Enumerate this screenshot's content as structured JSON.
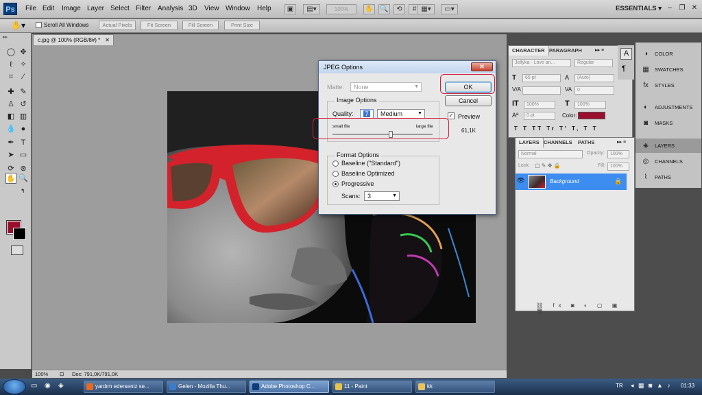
{
  "app": {
    "logo": "Ps",
    "workspace": "ESSENTIALS ▾"
  },
  "menu": [
    "File",
    "Edit",
    "Image",
    "Layer",
    "Select",
    "Filter",
    "Analysis",
    "3D",
    "View",
    "Window",
    "Help"
  ],
  "menubar_zoom": "100%",
  "options_bar": {
    "scroll_all_windows": "Scroll All Windows",
    "actual_pixels": "Actual Pixels",
    "fit_screen": "Fit Screen",
    "fill_screen": "Fill Screen",
    "print_size": "Print Size"
  },
  "document": {
    "tab_title": "c.jpg @ 100% (RGB/8#) *",
    "zoom": "100%",
    "doc_info": "Doc: 791,0K/791,0K"
  },
  "colors": {
    "foreground": "#9b0f2e",
    "background": "#000000",
    "accent": "#3d8cf0",
    "highlight_red": "#d41d3a"
  },
  "character_panel": {
    "tabs": [
      "CHARACTER",
      "PARAGRAPH"
    ],
    "font_family": "Jellyka - Love an...",
    "font_style": "Regular",
    "font_size": "65 pt",
    "leading": "(Auto)",
    "tracking": "0",
    "vertical_scale": "100%",
    "horizontal_scale": "100%",
    "baseline_shift": "0 pt",
    "color_label": "Color:",
    "color_value": "#9b0f2e"
  },
  "layers_panel": {
    "tabs": [
      "LAYERS",
      "CHANNELS",
      "PATHS"
    ],
    "blend_mode": "Normal",
    "opacity_label": "Opacity:",
    "opacity": "100%",
    "lock_label": "Lock:",
    "fill_label": "Fill:",
    "fill": "100%",
    "layers": [
      {
        "name": "Background"
      }
    ]
  },
  "dock": [
    {
      "label": "COLOR",
      "icon": "color-icon"
    },
    {
      "label": "SWATCHES",
      "icon": "swatches-icon"
    },
    {
      "label": "STYLES",
      "icon": "styles-icon"
    },
    {
      "label": "ADJUSTMENTS",
      "icon": "adjustments-icon"
    },
    {
      "label": "MASKS",
      "icon": "masks-icon"
    },
    {
      "label": "LAYERS",
      "icon": "layers-icon"
    },
    {
      "label": "CHANNELS",
      "icon": "channels-icon"
    },
    {
      "label": "PATHS",
      "icon": "paths-icon"
    }
  ],
  "dialog": {
    "title": "JPEG Options",
    "matte_label": "Matte:",
    "matte_value": "None",
    "image_options_title": "Image Options",
    "quality_label": "Quality:",
    "quality_value": "7",
    "quality_preset": "Medium",
    "small_file": "small file",
    "large_file": "large file",
    "quality_slider_fraction": 0.58,
    "format_options_title": "Format Options",
    "format_baseline_standard": "Baseline (\"Standard\")",
    "format_baseline_optimized": "Baseline Optimized",
    "format_progressive": "Progressive",
    "scans_label": "Scans:",
    "scans_value": "3",
    "ok": "OK",
    "cancel": "Cancel",
    "preview_label": "Preview",
    "file_size": "61,1K"
  },
  "taskbar": {
    "tasks": [
      {
        "label": "yardım ederseniz se...",
        "icon": "firefox-icon"
      },
      {
        "label": "Gelen - Mozilla Thu...",
        "icon": "thunderbird-icon"
      },
      {
        "label": "Adobe Photoshop C...",
        "icon": "photoshop-icon"
      },
      {
        "label": "11 - Paint",
        "icon": "paint-icon"
      },
      {
        "label": "kk",
        "icon": "folder-icon"
      }
    ],
    "language": "TR",
    "time": "01:33"
  }
}
